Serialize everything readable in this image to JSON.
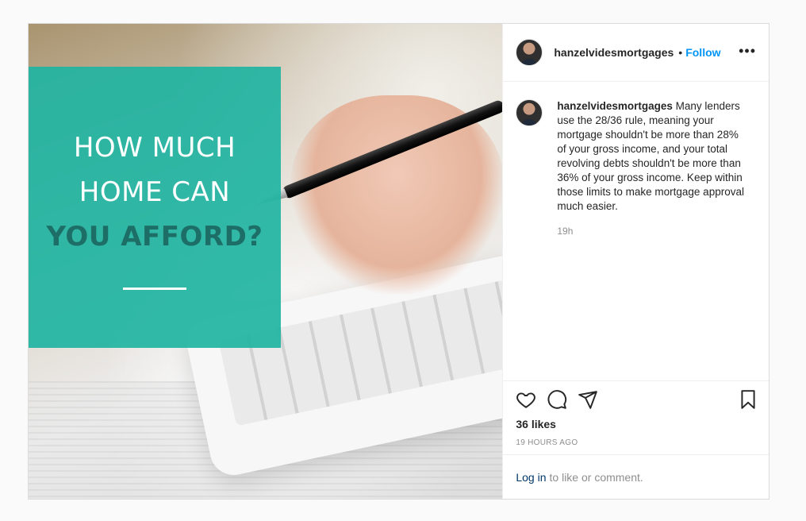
{
  "post": {
    "image": {
      "headline_line1": "HOW MUCH",
      "headline_line2": "HOME CAN",
      "headline_line3": "YOU AFFORD?",
      "accent_color": "#21b4a2"
    },
    "header": {
      "username": "hanzelvidesmortgages",
      "separator": "•",
      "follow_label": "Follow",
      "more_icon": "more-options-icon"
    },
    "caption": {
      "username": "hanzelvidesmortgages",
      "text": "Many lenders use the 28/36 rule, meaning your mortgage shouldn't be more than 28% of your gross income, and your total revolving debts shouldn't be more than 36% of your gross income. Keep within those limits to make mortgage approval much easier.",
      "time": "19h"
    },
    "actions": {
      "icons": [
        "heart-icon",
        "comment-icon",
        "share-icon",
        "bookmark-icon"
      ],
      "likes": "36 likes",
      "timestamp": "19 HOURS AGO"
    },
    "footer": {
      "login_link": "Log in",
      "login_text": "to like or comment."
    }
  }
}
